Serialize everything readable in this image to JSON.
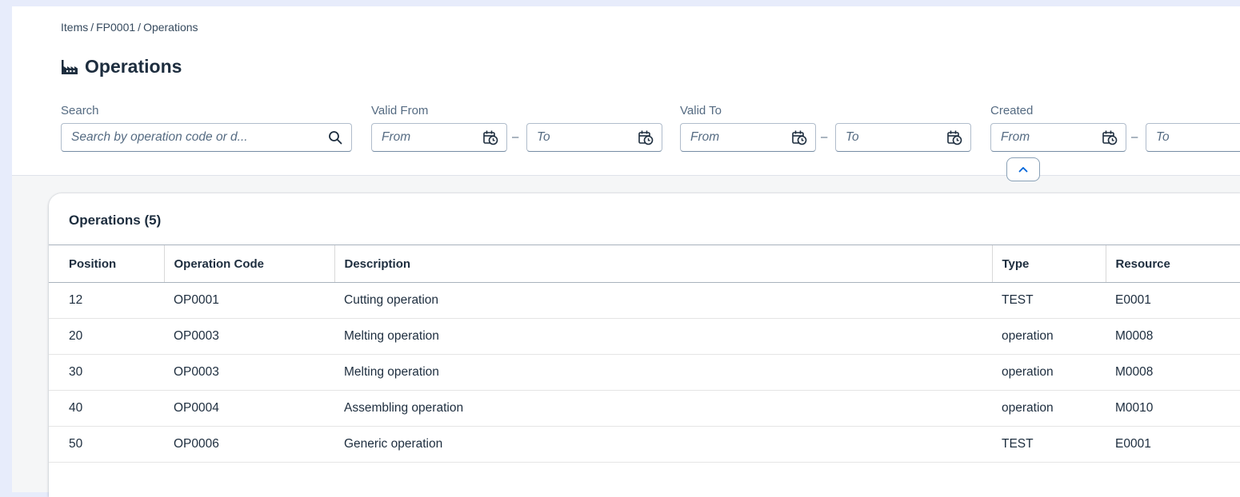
{
  "breadcrumb": {
    "items": [
      "Items",
      "FP0001",
      "Operations"
    ]
  },
  "page": {
    "title": "Operations",
    "icon": "factory-icon"
  },
  "filters": {
    "search": {
      "label": "Search",
      "placeholder": "Search by operation code or d..."
    },
    "valid_from": {
      "label": "Valid From",
      "from_placeholder": "From",
      "to_placeholder": "To"
    },
    "valid_to": {
      "label": "Valid To",
      "from_placeholder": "From",
      "to_placeholder": "To"
    },
    "created": {
      "label": "Created",
      "from_placeholder": "From",
      "to_placeholder": "To"
    },
    "range_separator": "–"
  },
  "table": {
    "title": "Operations (5)",
    "columns": [
      "Position",
      "Operation Code",
      "Description",
      "Type",
      "Resource"
    ],
    "rows": [
      {
        "position": "12",
        "code": "OP0001",
        "description": "Cutting operation",
        "type": "TEST",
        "resource": "E0001"
      },
      {
        "position": "20",
        "code": "OP0003",
        "description": "Melting operation",
        "type": "operation",
        "resource": "M0008"
      },
      {
        "position": "30",
        "code": "OP0003",
        "description": "Melting operation",
        "type": "operation",
        "resource": "M0008"
      },
      {
        "position": "40",
        "code": "OP0004",
        "description": "Assembling operation",
        "type": "operation",
        "resource": "M0010"
      },
      {
        "position": "50",
        "code": "OP0006",
        "description": "Generic operation",
        "type": "TEST",
        "resource": "E0001"
      }
    ]
  },
  "colors": {
    "accent": "#0064d9",
    "text": "#1d2d3e",
    "shell_background": "#e7ecfb"
  }
}
